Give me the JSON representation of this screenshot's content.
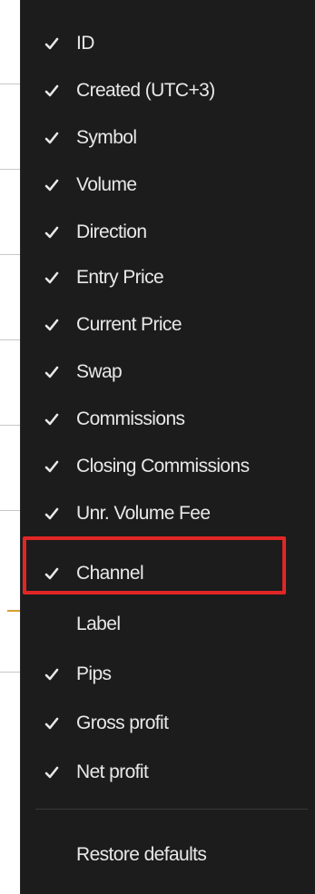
{
  "menu": {
    "items": [
      {
        "label": "ID",
        "checked": true
      },
      {
        "label": "Created (UTC+3)",
        "checked": true
      },
      {
        "label": "Symbol",
        "checked": true
      },
      {
        "label": "Volume",
        "checked": true
      },
      {
        "label": "Direction",
        "checked": true
      },
      {
        "label": "Entry Price",
        "checked": true
      },
      {
        "label": "Current Price",
        "checked": true
      },
      {
        "label": "Swap",
        "checked": true
      },
      {
        "label": "Commissions",
        "checked": true
      },
      {
        "label": "Closing Commissions",
        "checked": true
      },
      {
        "label": "Unr. Volume Fee",
        "checked": true
      },
      {
        "label": "Channel",
        "checked": true
      },
      {
        "label": "Label",
        "checked": false
      },
      {
        "label": "Pips",
        "checked": true
      },
      {
        "label": "Gross profit",
        "checked": true
      },
      {
        "label": "Net profit",
        "checked": true
      }
    ],
    "restore_label": "Restore defaults"
  },
  "colors": {
    "menu_background": "#1c1c1c",
    "text": "#e8e8e8",
    "check": "#e8e8e8",
    "highlight_border": "#e12626"
  },
  "icons": {
    "check": "checkmark-icon"
  }
}
